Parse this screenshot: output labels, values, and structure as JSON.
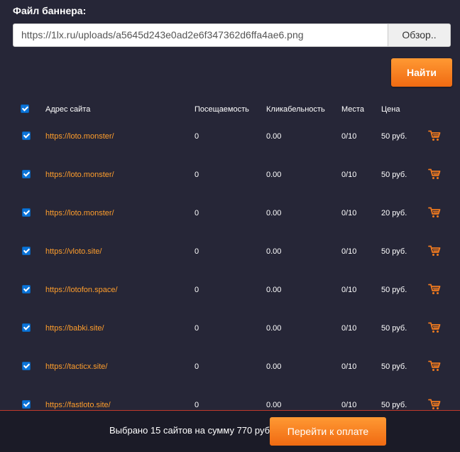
{
  "banner": {
    "label": "Файл баннера:",
    "file_path": "https://1lx.ru/uploads/a5645d243e0ad2e6f347362d6ffa4ae6.png",
    "browse_label": "Обзор.."
  },
  "find_label": "Найти",
  "table": {
    "headers": {
      "address": "Адрес сайта",
      "traffic": "Посещаемость",
      "ctr": "Кликабельность",
      "slots": "Места",
      "price": "Цена"
    },
    "rows": [
      {
        "site": "https://loto.monster/",
        "traffic": "0",
        "ctr": "0.00",
        "slots": "0/10",
        "price": "50 руб."
      },
      {
        "site": "https://loto.monster/",
        "traffic": "0",
        "ctr": "0.00",
        "slots": "0/10",
        "price": "50 руб."
      },
      {
        "site": "https://loto.monster/",
        "traffic": "0",
        "ctr": "0.00",
        "slots": "0/10",
        "price": "20 руб."
      },
      {
        "site": "https://vloto.site/",
        "traffic": "0",
        "ctr": "0.00",
        "slots": "0/10",
        "price": "50 руб."
      },
      {
        "site": "https://lotofon.space/",
        "traffic": "0",
        "ctr": "0.00",
        "slots": "0/10",
        "price": "50 руб."
      },
      {
        "site": "https://babki.site/",
        "traffic": "0",
        "ctr": "0.00",
        "slots": "0/10",
        "price": "50 руб."
      },
      {
        "site": "https://tacticx.site/",
        "traffic": "0",
        "ctr": "0.00",
        "slots": "0/10",
        "price": "50 руб."
      },
      {
        "site": "https://fastloto.site/",
        "traffic": "0",
        "ctr": "0.00",
        "slots": "0/10",
        "price": "50 руб."
      }
    ]
  },
  "footer": {
    "summary": "Выбрано 15 сайтов на сумму 770 руб.",
    "pay_label": "Перейти к оплате"
  },
  "icons": {
    "checkbox": "checkbox-checked-icon",
    "cart": "cart-icon"
  },
  "colors": {
    "background": "#262637",
    "accent": "#ff8a1f",
    "link": "#ff9e2c",
    "checkbox": "#0b74d9"
  }
}
